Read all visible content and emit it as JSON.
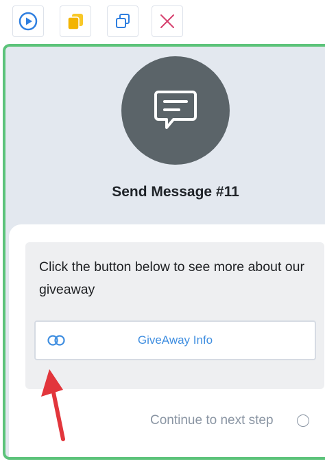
{
  "toolbar": {
    "buttons": [
      {
        "icon": "play-circle-icon",
        "color": "#2f7fe0"
      },
      {
        "icon": "copy-icon",
        "color": "#f3b400"
      },
      {
        "icon": "duplicate-icon",
        "color": "#2f7fe0"
      },
      {
        "icon": "close-icon",
        "color": "#d6406e"
      }
    ]
  },
  "step": {
    "title": "Send Message #11",
    "icon": "message-icon",
    "outline_color": "#5cc37a"
  },
  "message": {
    "text": "Click the button below to see more about our giveaway",
    "button": {
      "label": "GiveAway Info",
      "icon": "link-icon",
      "label_color": "#3f8ee0"
    }
  },
  "continue": {
    "label": "Continue to next step"
  },
  "annotation": {
    "icon": "red-arrow-icon",
    "color": "#e2363c"
  }
}
